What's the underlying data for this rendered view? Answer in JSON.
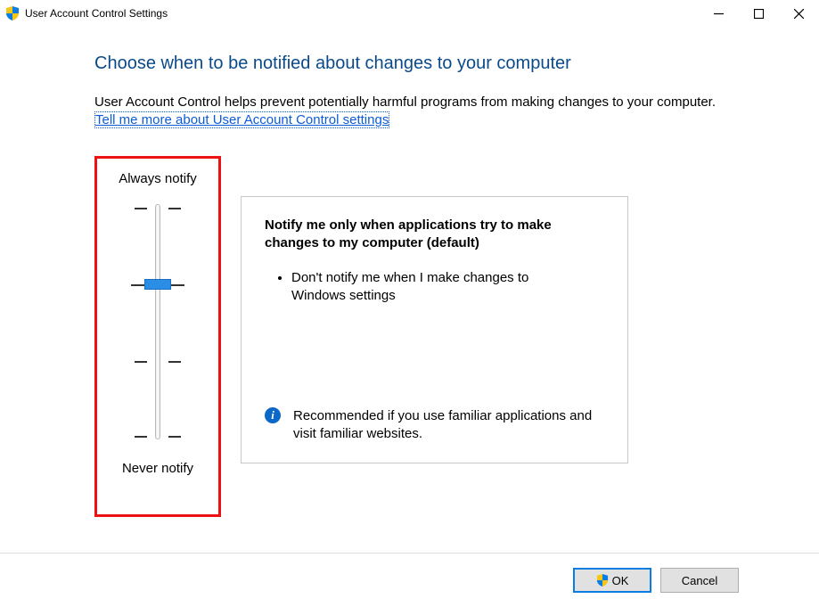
{
  "window": {
    "title": "User Account Control Settings"
  },
  "content": {
    "heading": "Choose when to be notified about changes to your computer",
    "description": "User Account Control helps prevent potentially harmful programs from making changes to your computer.",
    "link_text": "Tell me more about User Account Control settings"
  },
  "slider": {
    "top_label": "Always notify",
    "bottom_label": "Never notify",
    "levels": 4,
    "selected_index": 1
  },
  "panel": {
    "title": "Notify me only when applications try to make changes to my computer (default)",
    "bullets": [
      "Don't notify me when I make changes to Windows settings"
    ],
    "recommendation": "Recommended if you use familiar applications and visit familiar websites."
  },
  "buttons": {
    "ok": "OK",
    "cancel": "Cancel"
  }
}
